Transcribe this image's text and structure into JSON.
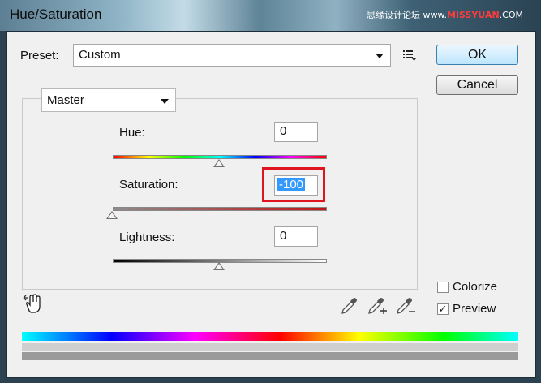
{
  "window": {
    "title": "Hue/Saturation",
    "watermark_prefix": "思缘设计论坛 www.",
    "watermark_highlight": "MISSYUAN",
    "watermark_suffix": ".COM"
  },
  "preset": {
    "label": "Preset:",
    "value": "Custom"
  },
  "buttons": {
    "ok": "OK",
    "cancel": "Cancel"
  },
  "channel": {
    "value": "Master"
  },
  "hue": {
    "label": "Hue:",
    "value": "0"
  },
  "saturation": {
    "label": "Saturation:",
    "value": "-100"
  },
  "lightness": {
    "label": "Lightness:",
    "value": "0"
  },
  "options": {
    "colorize_label": "Colorize",
    "colorize_checked": false,
    "preview_label": "Preview",
    "preview_checked": true
  },
  "icons": {
    "preset_options": "list-options-icon",
    "targeted_adjust": "hand-adjust-icon",
    "eyedropper": "eyedropper-icon",
    "eyedropper_add": "eyedropper-plus-icon",
    "eyedropper_subtract": "eyedropper-minus-icon"
  },
  "colors": {
    "highlight_border": "#e0141e",
    "selection": "#3399ff"
  }
}
